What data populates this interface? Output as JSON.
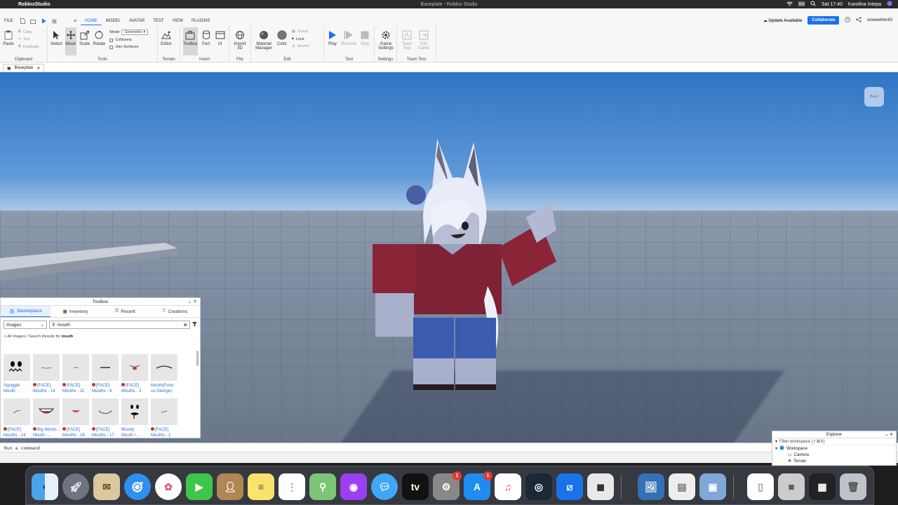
{
  "menubar": {
    "app_name": "RobloxStudio",
    "window_title": "Baseplate - Roblox Studio",
    "clock": "Sat 17:40",
    "user": "Karolina Intepa"
  },
  "ribbon": {
    "tabs": [
      "FILE",
      "HOME",
      "MODEL",
      "AVATAR",
      "TEST",
      "VIEW",
      "PLUGINS"
    ],
    "active_tab": "HOME",
    "update_label": "Update Available",
    "collaborate_label": "Collaborate",
    "username": "woweether63"
  },
  "clipboard": {
    "paste": "Paste",
    "copy": "Copy",
    "cut": "Cut",
    "duplicate": "Duplicate",
    "label": "Clipboard"
  },
  "tools": {
    "select": "Select",
    "move": "Move",
    "scale": "Scale",
    "rotate": "Rotate",
    "mode_label": "Mode:",
    "mode_value": "Geometric",
    "collisions": "Collisions",
    "join_surfaces": "Join Surfaces",
    "label": "Tools"
  },
  "terrain": {
    "editor": "Editor",
    "label": "Terrain"
  },
  "insert": {
    "toolbox": "Toolbox",
    "part": "Part",
    "ui": "UI",
    "label": "Insert"
  },
  "file": {
    "import3d": "Import 3D",
    "label": "File"
  },
  "edit": {
    "material_manager": "Material Manager",
    "color": "Color",
    "group": "Group",
    "lock": "Lock",
    "anchor": "Anchor",
    "label": "Edit"
  },
  "test": {
    "play": "Play",
    "resume": "Resume",
    "stop": "Stop",
    "label": "Test"
  },
  "settings": {
    "game_settings": "Game Settings",
    "label": "Settings"
  },
  "team_test": {
    "team_test": "Team Test",
    "exit_game": "Exit Game",
    "label": "Team Test"
  },
  "doc_tab": {
    "name": "Baseplate"
  },
  "viewport": {
    "back_label": "Back"
  },
  "toolbox_panel": {
    "title": "Toolbox",
    "tabs": [
      "Marketplace",
      "Inventory",
      "Recent",
      "Creations"
    ],
    "category": "Images",
    "search_value": "mouth",
    "breadcrumb_prefix": "< All Images / Search Results for",
    "breadcrumb_term": "mouth",
    "items": [
      {
        "name1": "Squiggle",
        "name2": "Mouth",
        "badge": false
      },
      {
        "name1": "[FACE]",
        "name2": "Mouths - 14",
        "badge": true
      },
      {
        "name1": "[FACE]",
        "name2": "Mouths - 11",
        "badge": true
      },
      {
        "name1": "[FACE]",
        "name2": "Mouths - 6",
        "badge": true
      },
      {
        "name1": "[FACE]",
        "name2": "Mouths - 3",
        "badge": true
      },
      {
        "name1": "Mouth(Furio",
        "name2": "us George)",
        "badge": false
      },
      {
        "name1": "[FACE]",
        "name2": "Mouths - 24",
        "badge": true
      },
      {
        "name1": "Big Words -",
        "name2": "Mouth -...",
        "badge": true
      },
      {
        "name1": "[FACE]",
        "name2": "Mouths - 18",
        "badge": true
      },
      {
        "name1": "[FACE]",
        "name2": "Mouths - 17",
        "badge": true
      },
      {
        "name1": "Bloody",
        "name2": "Mouth /...",
        "badge": false
      },
      {
        "name1": "[FACE]",
        "name2": "Mouths - 1",
        "badge": true
      }
    ]
  },
  "command_bar": {
    "placeholder": "Run a command"
  },
  "explorer": {
    "title": "Explorer",
    "filter_placeholder": "Filter workspace (⇧⌘X)",
    "workspace": "Workspace",
    "children": [
      "Camera",
      "Terrain"
    ]
  },
  "dock": {
    "badges": {
      "system_preferences": "1",
      "app_store": "1"
    }
  }
}
